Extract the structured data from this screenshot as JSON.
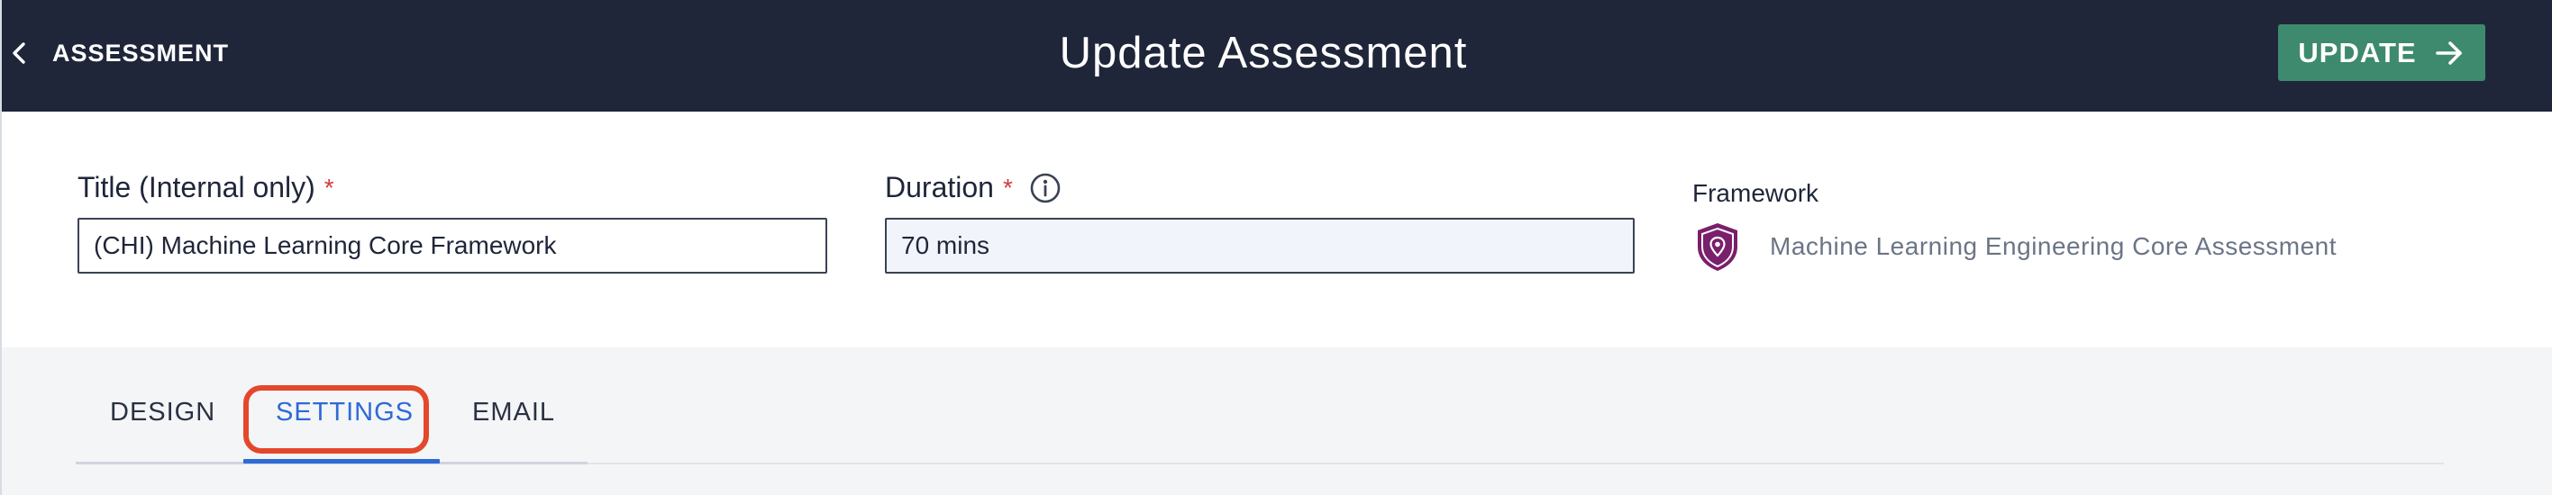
{
  "header": {
    "back_label": "ASSESSMENT",
    "title": "Update Assessment",
    "update_label": "UPDATE"
  },
  "form": {
    "title_field": {
      "label": "Title (Internal only)",
      "required_mark": "*",
      "value": "(CHI) Machine Learning Core Framework"
    },
    "duration_field": {
      "label": "Duration",
      "required_mark": "*",
      "value": "70 mins"
    },
    "framework": {
      "label": "Framework",
      "name": "Machine Learning Engineering Core Assessment",
      "icon": "shield-location-icon"
    }
  },
  "tabs": [
    {
      "label": "DESIGN",
      "active": false
    },
    {
      "label": "SETTINGS",
      "active": true
    },
    {
      "label": "EMAIL",
      "active": false
    }
  ],
  "colors": {
    "header_bg": "#1f2639",
    "update_button": "#3e8a6e",
    "active_tab": "#2d6ad6",
    "required": "#d63a3a",
    "highlight": "#e4472b",
    "framework_icon": "#7a1f6b"
  }
}
